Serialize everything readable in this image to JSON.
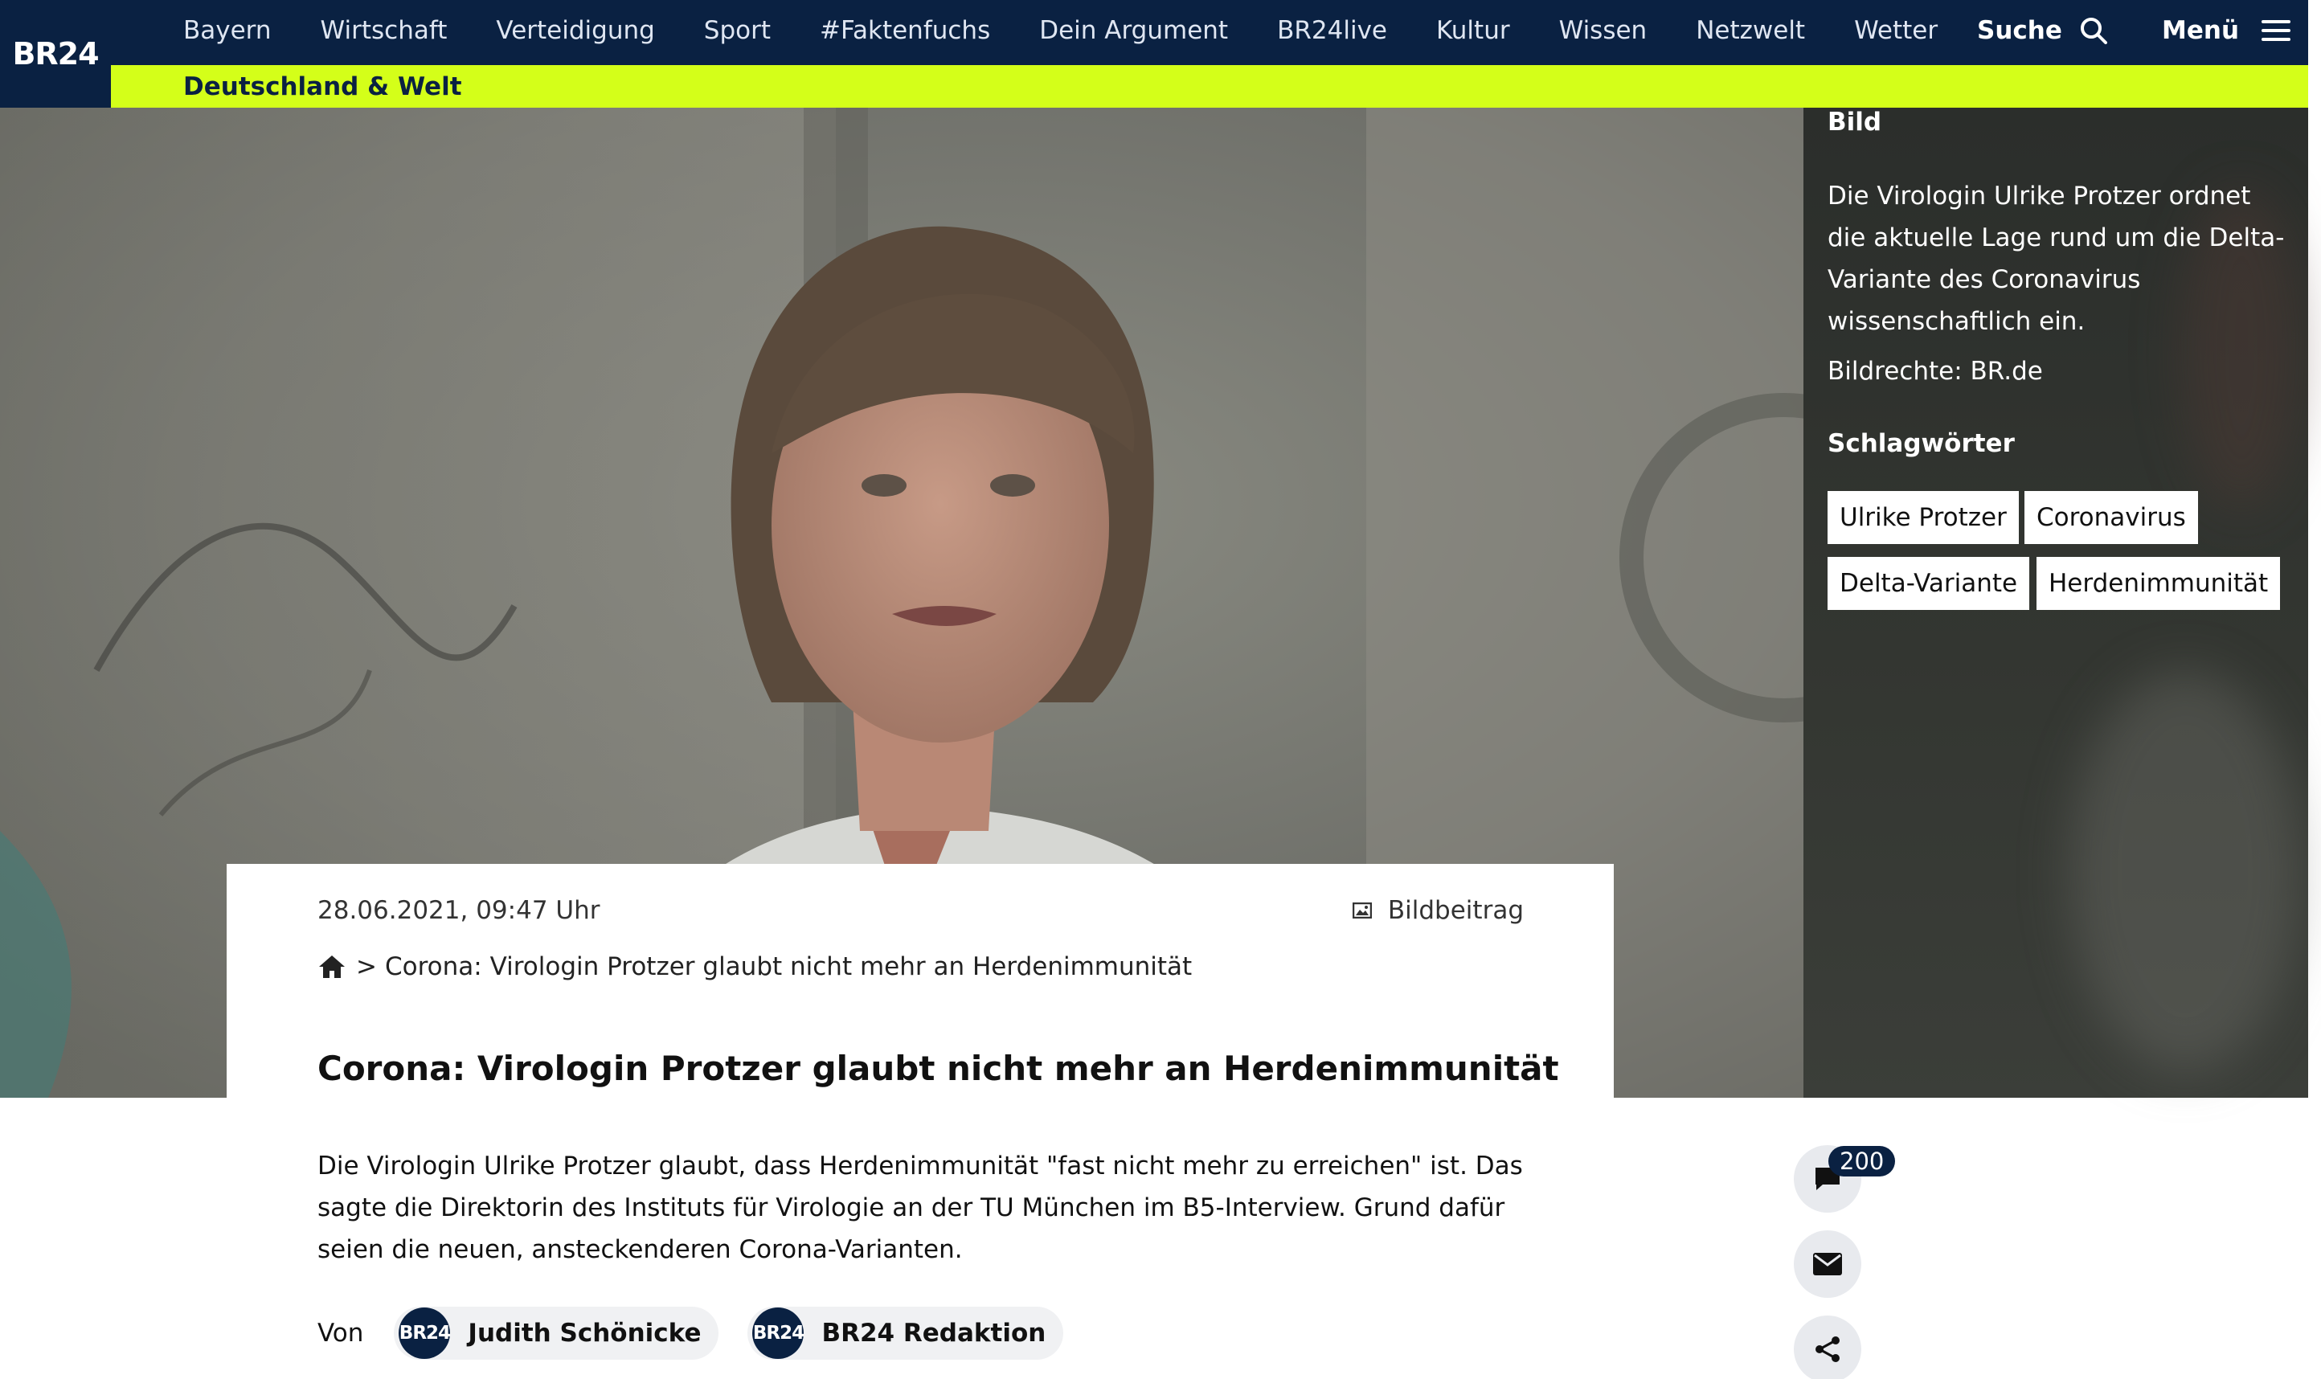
{
  "logo": {
    "text": "BR24"
  },
  "nav": {
    "items": [
      "Bayern",
      "Wirtschaft",
      "Verteidigung",
      "Sport",
      "#Faktenfuchs",
      "Dein Argument",
      "BR24live",
      "Kultur",
      "Wissen",
      "Netzwelt",
      "Wetter"
    ],
    "search_label": "Suche",
    "menu_label": "Menü"
  },
  "subnav": {
    "label": "Deutschland & Welt"
  },
  "panel": {
    "title": "Bild",
    "caption": "Die Virologin Ulrike Protzer ordnet die aktuelle Lage rund um die Delta-Variante des Coronavirus wissenschaftlich ein.",
    "credit": "Bildrechte: BR.de",
    "keywords_title": "Schlagwörter",
    "tags": [
      "Ulrike Protzer",
      "Coronavirus",
      "Delta-Variante",
      "Herdenimmunität"
    ]
  },
  "article": {
    "date": "28.06.2021, 09:47 Uhr",
    "type": "Bildbeitrag",
    "breadcrumb_separator": ">",
    "breadcrumb": "Corona: Virologin Protzer glaubt nicht mehr an Herdenimmunität",
    "headline": "Corona: Virologin Protzer glaubt nicht mehr an Herdenimmunität",
    "teaser": "Die Virologin Ulrike Protzer glaubt, dass Herdenimmunität \"fast nicht mehr zu erreichen\" ist. Das sagte die Direktorin des Instituts für Virologie an der TU München im B5-Interview. Grund dafür seien die neuen, ansteckenderen Corona-Varianten.",
    "by_label": "Von",
    "authors": [
      {
        "avatar": "BR24",
        "name": "Judith Schönicke"
      },
      {
        "avatar": "BR24",
        "name": "BR24 Redaktion"
      }
    ]
  },
  "actions": {
    "comment_count": "200"
  },
  "colors": {
    "navy": "#0a2142",
    "accent": "#d4ff19"
  }
}
